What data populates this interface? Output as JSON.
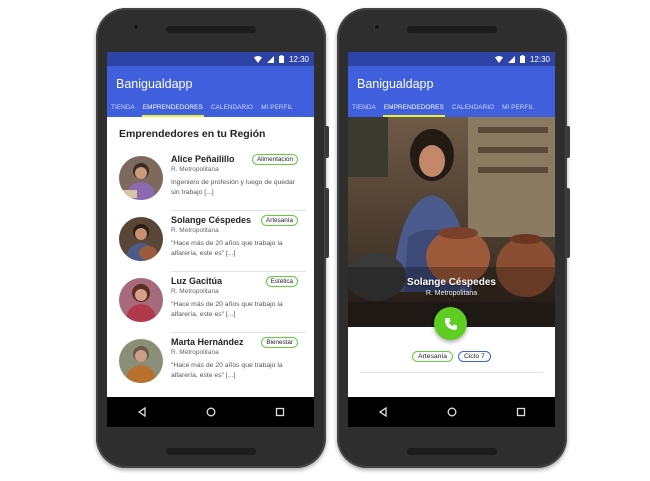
{
  "status_bar": {
    "time": "12:30"
  },
  "app": {
    "title": "Banigualdapp"
  },
  "tabs": [
    {
      "label": "TIENDA"
    },
    {
      "label": "EMPRENDEDORES",
      "active": true
    },
    {
      "label": "CALENDARIO"
    },
    {
      "label": "MI PERFIL"
    }
  ],
  "list_screen": {
    "section_title": "Emprendedores en tu Región",
    "items": [
      {
        "name": "Alice Peñailillo",
        "region": "R. Metropolitana",
        "badge": "Alimentación",
        "description": "Ingeniero de profesión y luego de quedar sin trabajo [...]"
      },
      {
        "name": "Solange Céspedes",
        "region": "R. Metropolitana",
        "badge": "Artesanía",
        "description": "\"Hace más de 20 años que trabajo la alfarería, este es\" [...]"
      },
      {
        "name": "Luz Gacitúa",
        "region": "R. Metropolitana",
        "badge": "Estética",
        "description": "\"Hace más de 20 años que trabajo la alfarería, este es\" [...]"
      },
      {
        "name": "Marta Hernández",
        "region": "R. Metropolitana",
        "badge": "Bienestar",
        "description": "\"Hace más de 20 años que trabajo la alfarería, este es\" [...]"
      }
    ]
  },
  "detail_screen": {
    "name": "Solange Céspedes",
    "region": "R. Metropolitana",
    "chips": [
      {
        "label": "Artesanía",
        "color": "#5fcf3a"
      },
      {
        "label": "Ciclo 7",
        "color": "#3f5fdc"
      }
    ]
  },
  "colors": {
    "primary": "#3f5fdc",
    "primary_dark": "#2d44a6",
    "accent": "#e6f03c",
    "fab": "#5fce22",
    "badge": "#5fcf3a"
  },
  "icons": [
    "wifi-icon",
    "signal-icon",
    "battery-icon",
    "back-icon",
    "home-icon",
    "recents-icon",
    "phone-call-icon"
  ]
}
